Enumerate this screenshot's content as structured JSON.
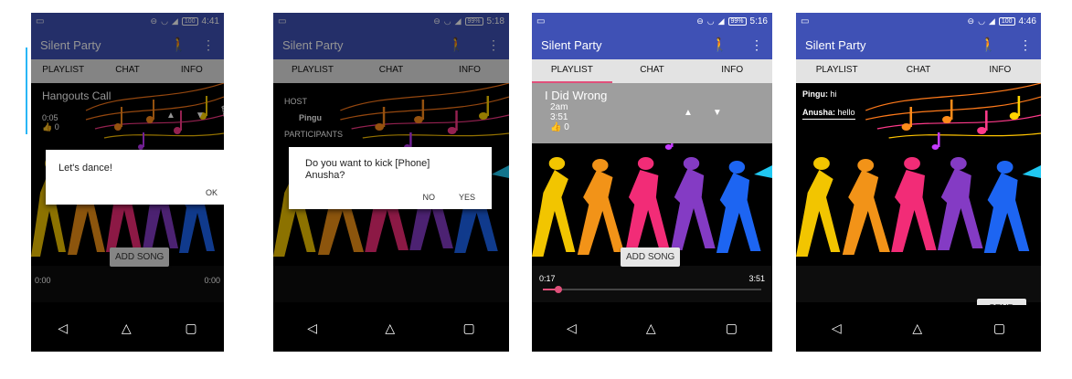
{
  "screens": [
    {
      "status": {
        "battery": "100",
        "time": "4:41"
      },
      "appbar": {
        "title": "Silent Party"
      },
      "tabs": [
        "PLAYLIST",
        "CHAT",
        "INFO"
      ],
      "song": {
        "title": "Hangouts Call",
        "duration": "0:05",
        "likes": "0"
      },
      "dialog": {
        "message": "Let's dance!",
        "ok": "OK"
      },
      "add_song": "ADD SONG",
      "elapsed": "0:00",
      "total": "0:00"
    },
    {
      "status": {
        "battery": "99%",
        "time": "5:18"
      },
      "appbar": {
        "title": "Silent Party"
      },
      "tabs": [
        "PLAYLIST",
        "CHAT",
        "INFO"
      ],
      "info": {
        "host_label": "HOST",
        "host": "Pingu",
        "participants_label": "PARTICIPANTS"
      },
      "dialog": {
        "message": "Do you want to kick [Phone] Anusha?",
        "no": "NO",
        "yes": "YES"
      }
    },
    {
      "status": {
        "battery": "99%",
        "time": "5:16"
      },
      "appbar": {
        "title": "Silent Party"
      },
      "tabs": [
        "PLAYLIST",
        "CHAT",
        "INFO"
      ],
      "song": {
        "title": "I Did Wrong",
        "artist": "2am",
        "duration": "3:51",
        "likes": "0"
      },
      "add_song": "ADD SONG",
      "elapsed": "0:17",
      "total": "3:51",
      "progress": 0.07
    },
    {
      "status": {
        "battery": "100",
        "time": "4:46"
      },
      "appbar": {
        "title": "Silent Party"
      },
      "tabs": [
        "PLAYLIST",
        "CHAT",
        "INFO"
      ],
      "chat": [
        {
          "user": "Pingu:",
          "text": "hi"
        },
        {
          "user": "Anusha:",
          "text": "hello"
        }
      ],
      "send": "SEND"
    }
  ],
  "colors": {
    "appbar": "#3f51b5",
    "accent": "#e0507a",
    "tabbar": "#e3e3e3",
    "song_row": "#9e9e9e"
  }
}
